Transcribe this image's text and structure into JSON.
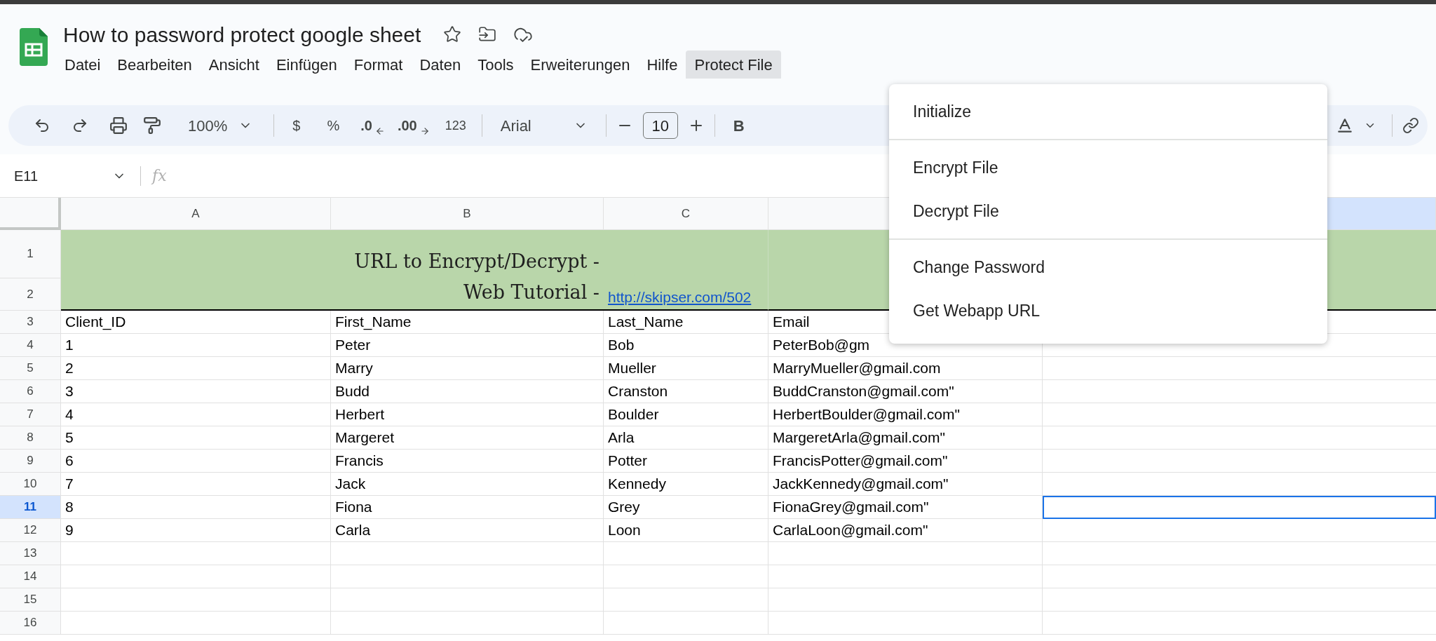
{
  "document": {
    "title": "How to password protect google sheet"
  },
  "menu_bar": [
    {
      "label": "Datei",
      "selected": false
    },
    {
      "label": "Bearbeiten",
      "selected": false
    },
    {
      "label": "Ansicht",
      "selected": false
    },
    {
      "label": "Einfügen",
      "selected": false
    },
    {
      "label": "Format",
      "selected": false
    },
    {
      "label": "Daten",
      "selected": false
    },
    {
      "label": "Tools",
      "selected": false
    },
    {
      "label": "Erweiterungen",
      "selected": false
    },
    {
      "label": "Hilfe",
      "selected": false
    },
    {
      "label": "Protect File",
      "selected": true
    }
  ],
  "toolbar": {
    "zoom": "100%",
    "currency": "$",
    "percent": "%",
    "decrease_decimals": ".0",
    "increase_decimals": ".00",
    "number_format": "123",
    "font": "Arial",
    "font_size": "10",
    "bold": "B"
  },
  "formula_bar": {
    "cell_reference": "E11",
    "fx": "fx"
  },
  "columns": [
    {
      "label": "A",
      "selected": false
    },
    {
      "label": "B",
      "selected": false
    },
    {
      "label": "C",
      "selected": false
    },
    {
      "selected": false
    },
    {
      "selected": true
    }
  ],
  "banner": {
    "row_numbers": [
      "1",
      "2"
    ],
    "lines": [
      "URL to Encrypt/Decrypt -",
      "Web Tutorial -"
    ],
    "link": "http://skipser.com/502"
  },
  "rows": [
    {
      "number": "3",
      "selected": false,
      "cells": [
        "Client_ID",
        "First_Name",
        "Last_Name",
        "Email"
      ]
    },
    {
      "number": "4",
      "selected": false,
      "cells": [
        "1",
        "Peter",
        "Bob",
        "PeterBob@gm"
      ]
    },
    {
      "number": "5",
      "selected": false,
      "cells": [
        "2",
        "Marry",
        "Mueller",
        "MarryMueller@gmail.com"
      ]
    },
    {
      "number": "6",
      "selected": false,
      "cells": [
        "3",
        "Budd",
        "Cranston",
        "BuddCranston@gmail.com\""
      ]
    },
    {
      "number": "7",
      "selected": false,
      "cells": [
        "4",
        "Herbert",
        "Boulder",
        "HerbertBoulder@gmail.com\""
      ]
    },
    {
      "number": "8",
      "selected": false,
      "cells": [
        "5",
        "Margeret",
        "Arla",
        "MargeretArla@gmail.com\""
      ]
    },
    {
      "number": "9",
      "selected": false,
      "cells": [
        "6",
        "Francis",
        "Potter",
        "FrancisPotter@gmail.com\""
      ]
    },
    {
      "number": "10",
      "selected": false,
      "cells": [
        "7",
        "Jack",
        "Kennedy",
        "JackKennedy@gmail.com\""
      ]
    },
    {
      "number": "11",
      "selected": true,
      "cells": [
        "8",
        "Fiona",
        "Grey",
        "FionaGrey@gmail.com\""
      ]
    },
    {
      "number": "12",
      "selected": false,
      "cells": [
        "9",
        "Carla",
        "Loon",
        "CarlaLoon@gmail.com\""
      ]
    },
    {
      "number": "13",
      "selected": false
    },
    {
      "number": "14",
      "selected": false
    },
    {
      "number": "15",
      "selected": false
    },
    {
      "number": "16",
      "selected": false
    }
  ],
  "dropdown": {
    "groups": [
      [
        "Initialize"
      ],
      [
        "Encrypt File",
        "Decrypt File"
      ],
      [
        "Change Password",
        "Get Webapp URL"
      ]
    ]
  }
}
